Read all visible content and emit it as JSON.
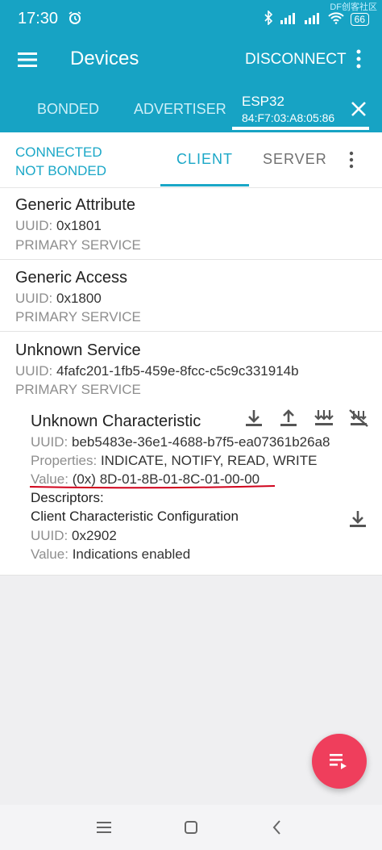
{
  "status": {
    "time": "17:30",
    "battery": "66",
    "watermark": "DF创客社区"
  },
  "appbar": {
    "title": "Devices",
    "disconnect": "DISCONNECT"
  },
  "tabs": {
    "bonded": "BONDED",
    "advertiser": "ADVERTISER",
    "device_name": "ESP32",
    "device_mac": "84:F7:03:A8:05:86"
  },
  "connection": {
    "state": "CONNECTED",
    "bond": "NOT BONDED",
    "client": "CLIENT",
    "server": "SERVER"
  },
  "services": [
    {
      "name": "Generic Attribute",
      "uuid_label": "UUID:",
      "uuid": "0x1801",
      "type": "PRIMARY SERVICE"
    },
    {
      "name": "Generic Access",
      "uuid_label": "UUID:",
      "uuid": "0x1800",
      "type": "PRIMARY SERVICE"
    },
    {
      "name": "Unknown Service",
      "uuid_label": "UUID:",
      "uuid": "4fafc201-1fb5-459e-8fcc-c5c9c331914b",
      "type": "PRIMARY SERVICE"
    }
  ],
  "characteristic": {
    "name": "Unknown Characteristic",
    "uuid_label": "UUID:",
    "uuid": "beb5483e-36e1-4688-b7f5-ea07361b26a8",
    "props_label": "Properties:",
    "props": "INDICATE, NOTIFY, READ, WRITE",
    "value_label": "Value:",
    "value": "(0x) 8D-01-8B-01-8C-01-00-00",
    "descriptors_label": "Descriptors:",
    "descriptor_name": "Client Characteristic Configuration",
    "descriptor_uuid": "0x2902",
    "descriptor_value": "Indications enabled"
  },
  "colors": {
    "primary": "#17a3c4",
    "accent": "#1aa7c7",
    "fab": "#ef3e5c",
    "annotation": "#d0021b"
  },
  "icons": [
    "menu-icon",
    "alarm-icon",
    "bluetooth-icon",
    "signal-icon",
    "wifi-icon",
    "battery-icon",
    "more-vert-icon",
    "close-icon",
    "download-icon",
    "upload-icon",
    "multi-download-icon",
    "notify-off-icon",
    "list-icon",
    "nav-menu-icon",
    "nav-home-icon",
    "nav-back-icon"
  ]
}
